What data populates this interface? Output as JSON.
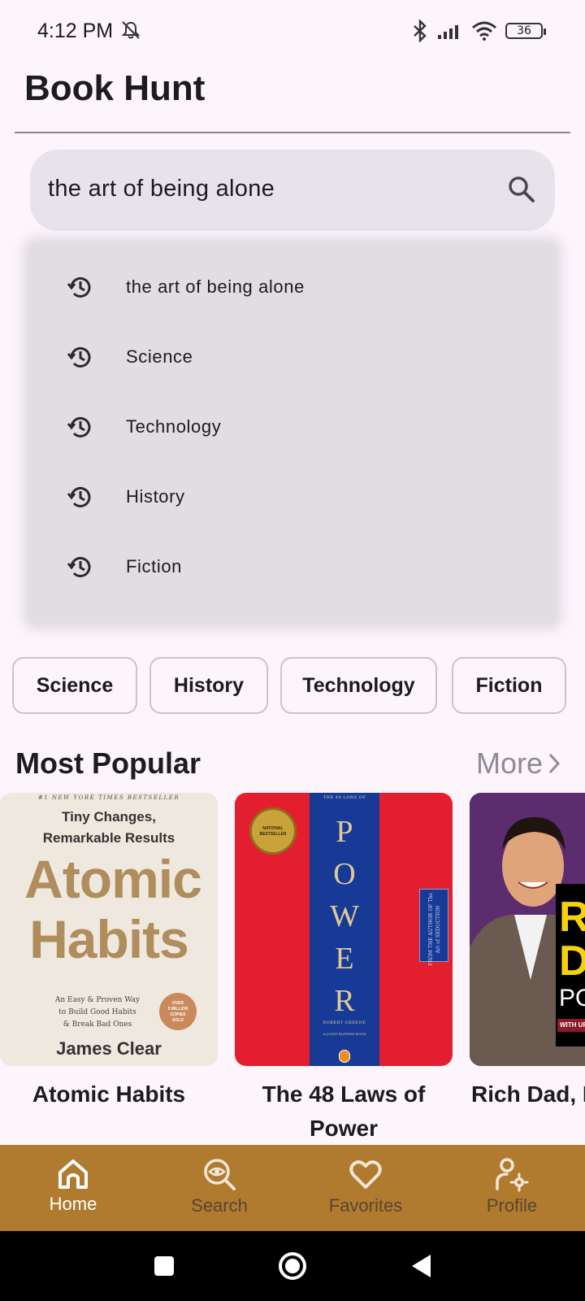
{
  "status_bar": {
    "time": "4:12 PM",
    "battery": "36"
  },
  "app": {
    "title": "Book Hunt"
  },
  "search": {
    "query": "the art of being alone"
  },
  "suggestions": [
    {
      "label": "the art of being alone",
      "icon": "history-icon"
    },
    {
      "label": "Science",
      "icon": "history-icon"
    },
    {
      "label": "Technology",
      "icon": "history-icon"
    },
    {
      "label": "History",
      "icon": "history-icon"
    },
    {
      "label": "Fiction",
      "icon": "history-icon"
    }
  ],
  "categories": [
    "Science",
    "History",
    "Technology",
    "Fiction"
  ],
  "most_popular": {
    "title": "Most Popular",
    "more_label": "More",
    "books": [
      {
        "title": "Atomic Habits",
        "cover": {
          "banner": "#1 NEW YORK TIMES BESTSELLER",
          "tagline_1": "Tiny Changes,",
          "tagline_2": "Remarkable Results",
          "title_1": "Atomic",
          "title_2": "Habits",
          "subtitle_1": "An Easy & Proven Way",
          "subtitle_2": "to Build Good Habits",
          "subtitle_3": "& Break Bad Ones",
          "badge_1": "OVER",
          "badge_2": "5 MILLION",
          "badge_3": "COPIES",
          "badge_4": "SOLD",
          "author": "James Clear"
        }
      },
      {
        "title": "The 48 Laws of Power",
        "cover": {
          "top": "THE 48 LAWS OF",
          "seal_1": "NATIONAL",
          "seal_2": "BESTSELLER",
          "letters": [
            "P",
            "O",
            "W",
            "E",
            "R"
          ],
          "side_1": "FROM THE AUTHOR OF",
          "side_2": "The Art of",
          "side_3": "SEDUCTION",
          "author": "ROBERT GREENE",
          "footer": "A JOOST ELFFERS BOOK"
        }
      },
      {
        "title": "Rich Dad, Poor Dad",
        "cover": {
          "letter_1": "R",
          "letter_2": "D",
          "partial": "PO",
          "strip": "WITH UPD"
        }
      }
    ]
  },
  "bottom_nav": {
    "items": [
      {
        "label": "Home",
        "icon": "home-icon",
        "active": true
      },
      {
        "label": "Search",
        "icon": "search-icon",
        "active": false
      },
      {
        "label": "Favorites",
        "icon": "heart-icon",
        "active": false
      },
      {
        "label": "Profile",
        "icon": "profile-settings-icon",
        "active": false
      }
    ]
  },
  "colors": {
    "background": "#fcf5fc",
    "nav_bar": "#b07a2f",
    "search_bg": "#e8e2ea",
    "inactive_nav_label": "#5a4630"
  }
}
